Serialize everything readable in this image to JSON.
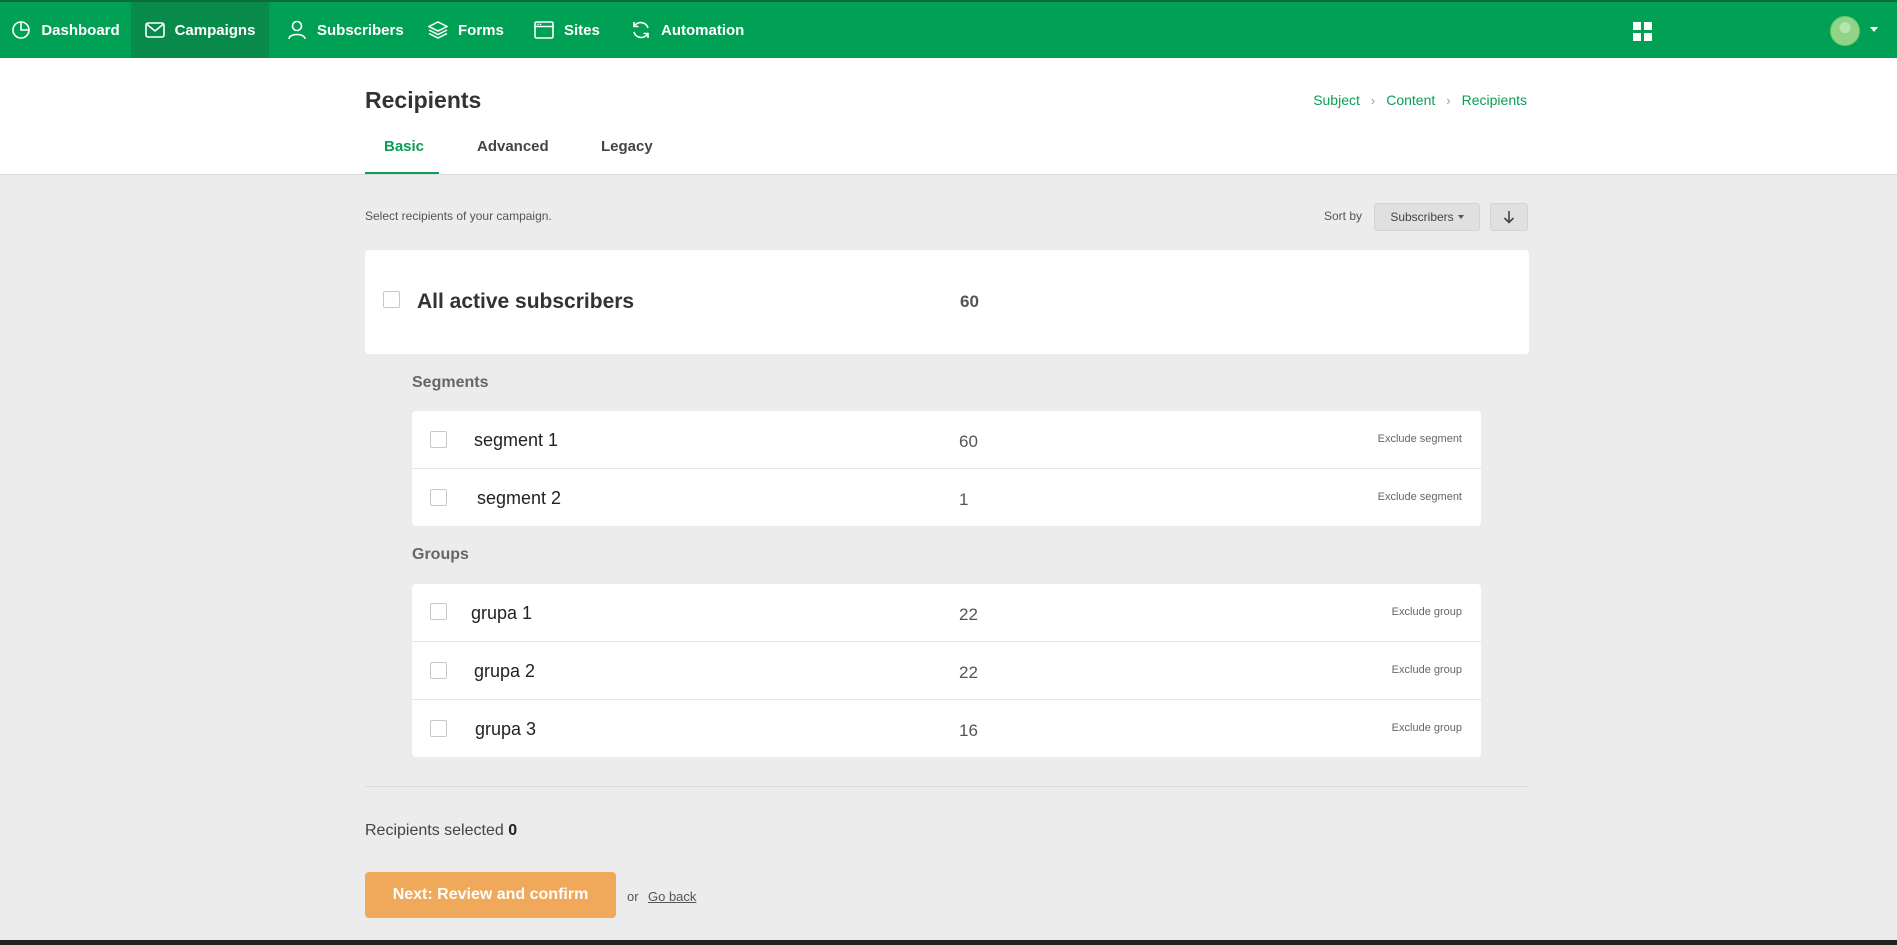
{
  "nav": {
    "items": [
      {
        "label": "Dashboard",
        "icon": "clock-pie-icon"
      },
      {
        "label": "Campaigns",
        "icon": "envelope-icon",
        "active": true
      },
      {
        "label": "Subscribers",
        "icon": "user-icon"
      },
      {
        "label": "Forms",
        "icon": "layers-icon"
      },
      {
        "label": "Sites",
        "icon": "browser-window-icon"
      },
      {
        "label": "Automation",
        "icon": "refresh-icon"
      }
    ]
  },
  "header": {
    "title": "Recipients",
    "breadcrumb": [
      "Subject",
      "Content",
      "Recipients"
    ],
    "tabs": [
      "Basic",
      "Advanced",
      "Legacy"
    ]
  },
  "toolbar": {
    "intro": "Select recipients of your campaign.",
    "sort_label": "Sort by",
    "sort_value": "Subscribers"
  },
  "all": {
    "label": "All active subscribers",
    "count": "60"
  },
  "segments": {
    "title": "Segments",
    "items": [
      {
        "name": "segment 1",
        "count": "60",
        "exclude": "Exclude segment"
      },
      {
        "name": "segment 2",
        "count": "1",
        "exclude": "Exclude segment"
      }
    ]
  },
  "groups": {
    "title": "Groups",
    "items": [
      {
        "name": "grupa 1",
        "count": "22",
        "exclude": "Exclude group"
      },
      {
        "name": "grupa 2",
        "count": "22",
        "exclude": "Exclude group"
      },
      {
        "name": "grupa 3",
        "count": "16",
        "exclude": "Exclude group"
      }
    ]
  },
  "footer": {
    "selected_label": "Recipients selected",
    "selected_count": "0",
    "next_label": "Next: Review and confirm",
    "or": "or",
    "go_back": "Go back"
  },
  "colors": {
    "brand": "#00a154",
    "accent_button": "#f0a95b",
    "link": "#0b9e56"
  }
}
